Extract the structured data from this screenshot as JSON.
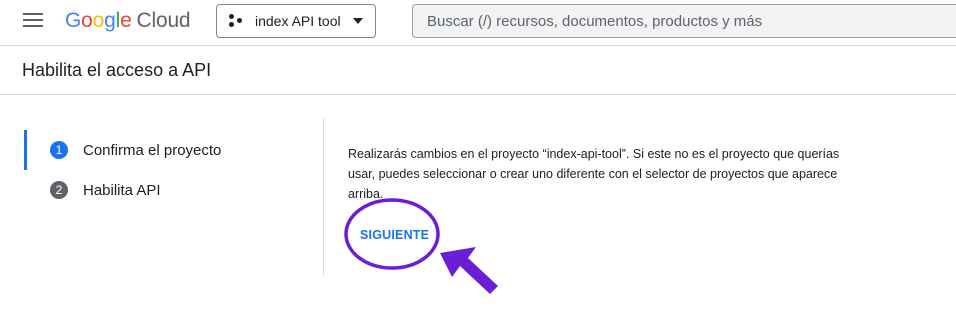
{
  "header": {
    "logo": {
      "G": "G",
      "o1": "o",
      "o2": "o",
      "g": "g",
      "l": "l",
      "e": "e",
      "cloud": "Cloud"
    },
    "project_picker": {
      "label": "index API tool"
    },
    "search": {
      "placeholder": "Buscar (/) recursos, documentos, productos y más",
      "value": ""
    }
  },
  "page": {
    "title": "Habilita el acceso a API"
  },
  "steps": [
    {
      "number": "1",
      "label": "Confirma el proyecto",
      "active": true
    },
    {
      "number": "2",
      "label": "Habilita API",
      "active": false
    }
  ],
  "content": {
    "description": "Realizarás cambios en el proyecto “index-api-tool”. Si este no es el proyecto que querías usar, puedes seleccionar o crear uno diferente con el selector de proyectos que aparece arriba.",
    "next_button": "SIGUIENTE"
  },
  "colors": {
    "accent": "#1a73e8",
    "annotation": "#6a1fd6"
  },
  "icons": [
    "menu-icon",
    "project-icon",
    "dropdown-caret-icon"
  ]
}
